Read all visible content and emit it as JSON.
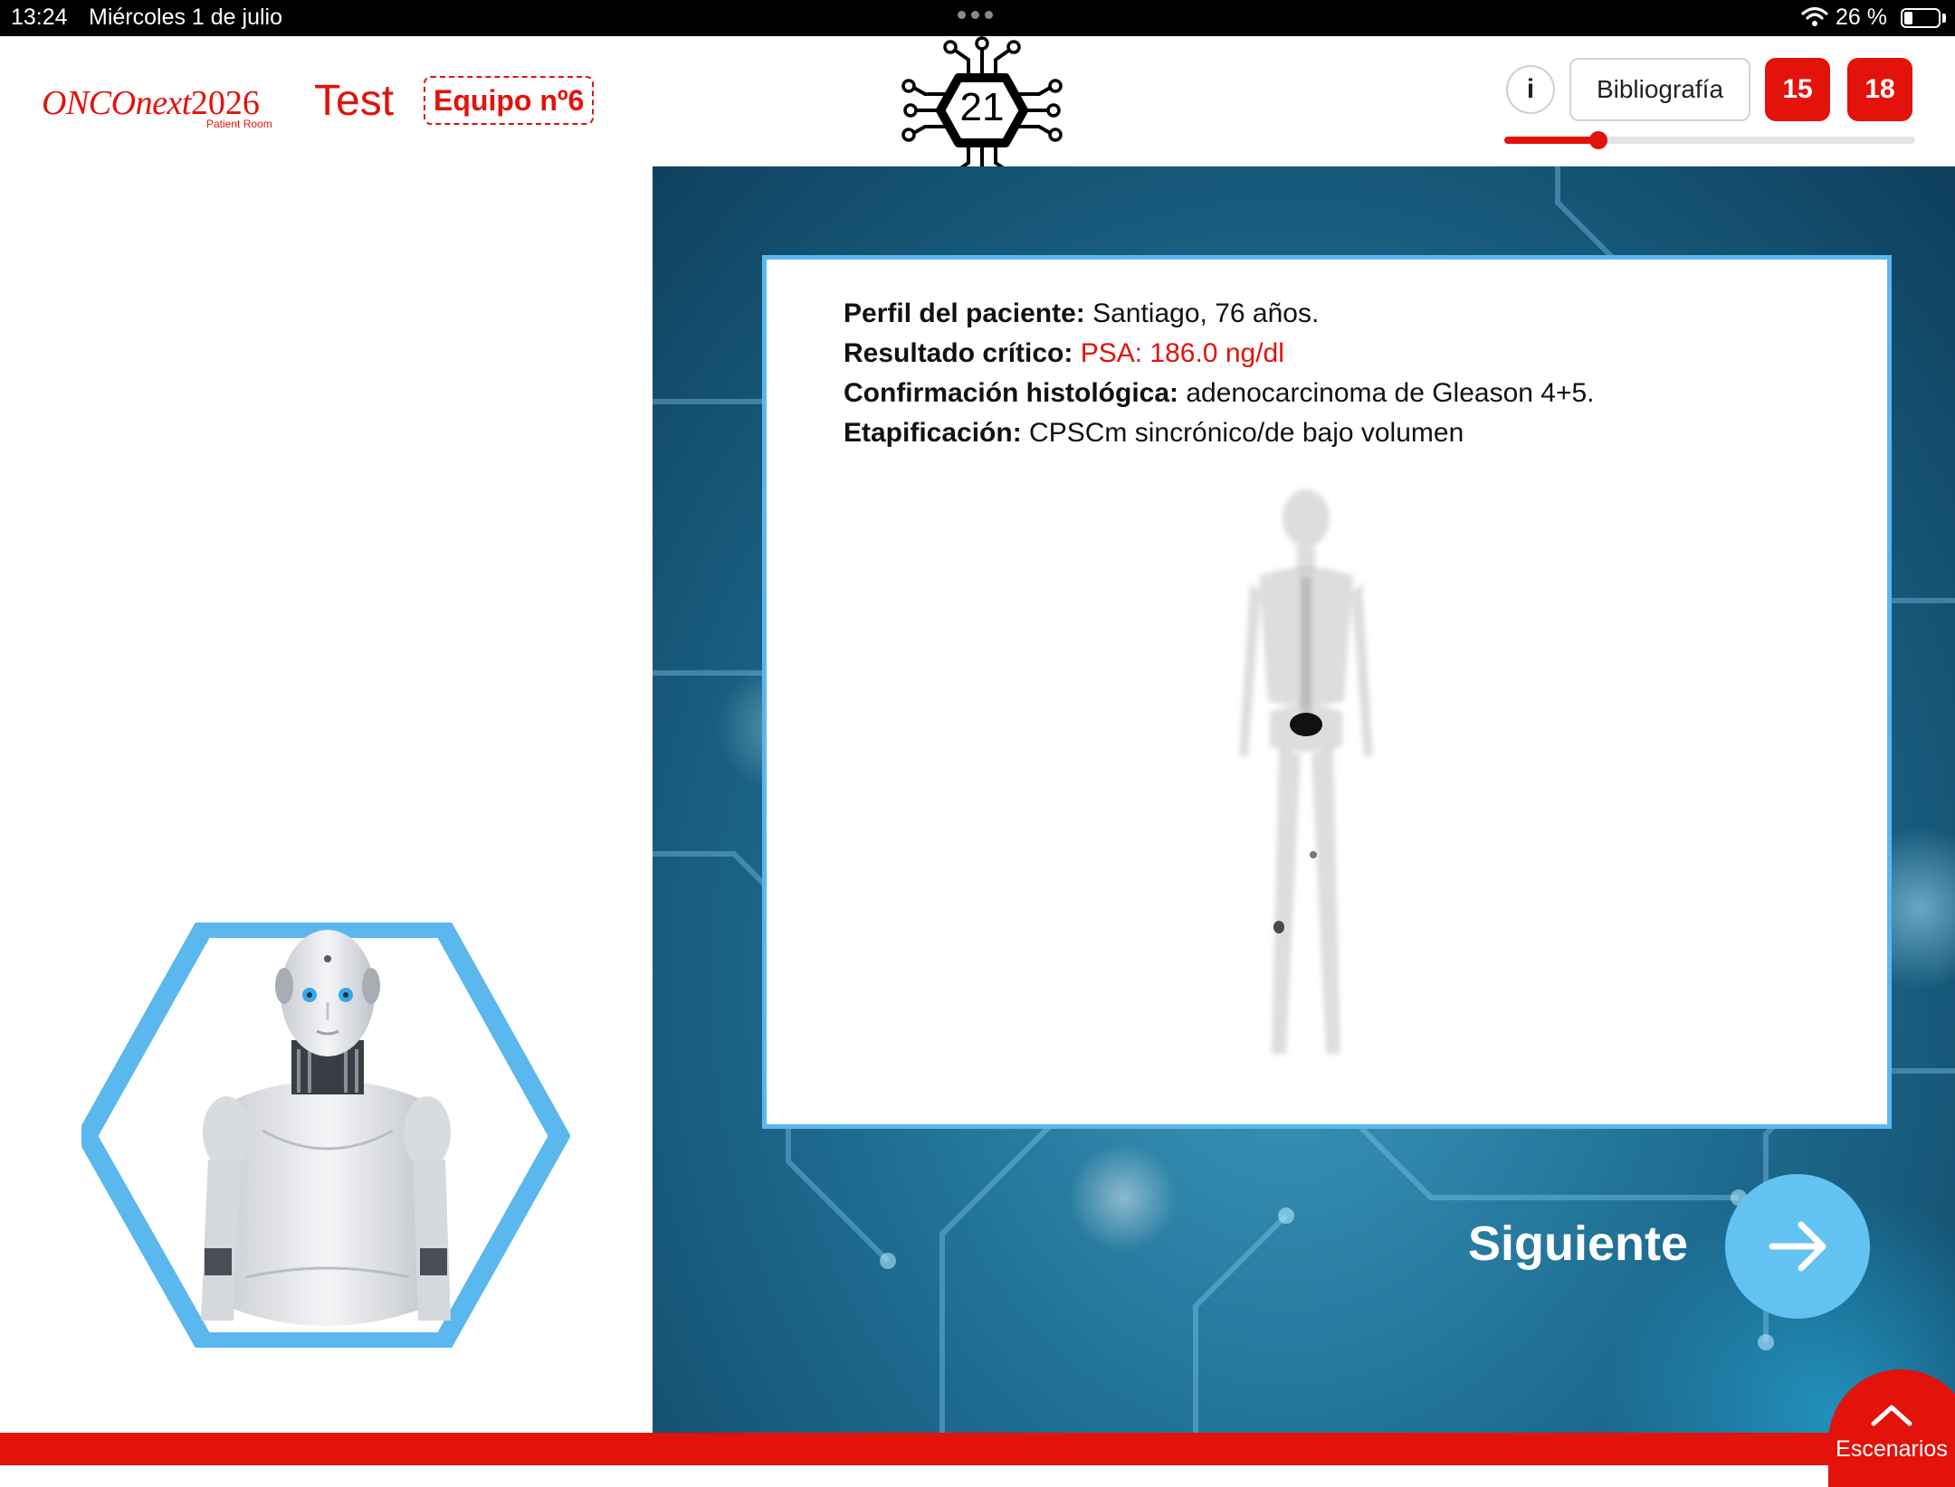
{
  "status_bar": {
    "time": "13:24",
    "date": "Miércoles 1 de julio",
    "battery": "26 %",
    "battery_level": 0.26
  },
  "header": {
    "logo_brand": "ONCOnext",
    "logo_year": "2026",
    "logo_sub": "Patient Room",
    "page_label": "Test",
    "team_label": "Equipo nº6",
    "scenario_number": "21",
    "info_label": "i",
    "bibliography_label": "Bibliografía",
    "counter_a": "15",
    "counter_b": "18",
    "progress": 0.23
  },
  "card": {
    "profile_label": "Perfil del paciente:",
    "profile_value": "Santiago, 76 años.",
    "critical_label": "Resultado crítico:",
    "critical_value": "PSA: 186.0 ng/dl",
    "histology_label": "Confirmación histológica:",
    "histology_value": "adenocarcinoma de Gleason 4+5.",
    "staging_label": "Etapificación:",
    "staging_value": "CPSCm sincrónico/de bajo volumen"
  },
  "navigation": {
    "next_label": "Siguiente",
    "scenarios_label": "Escenarios"
  },
  "colors": {
    "brand_red": "#e3120b",
    "accent_blue": "#5ab8ee",
    "next_button": "#62c3f3"
  },
  "icons": {
    "wifi": "wifi-icon",
    "battery": "battery-icon",
    "next": "arrow-right-icon",
    "scenarios": "chevron-up-icon",
    "badge": "circuit-hexagon-icon"
  }
}
